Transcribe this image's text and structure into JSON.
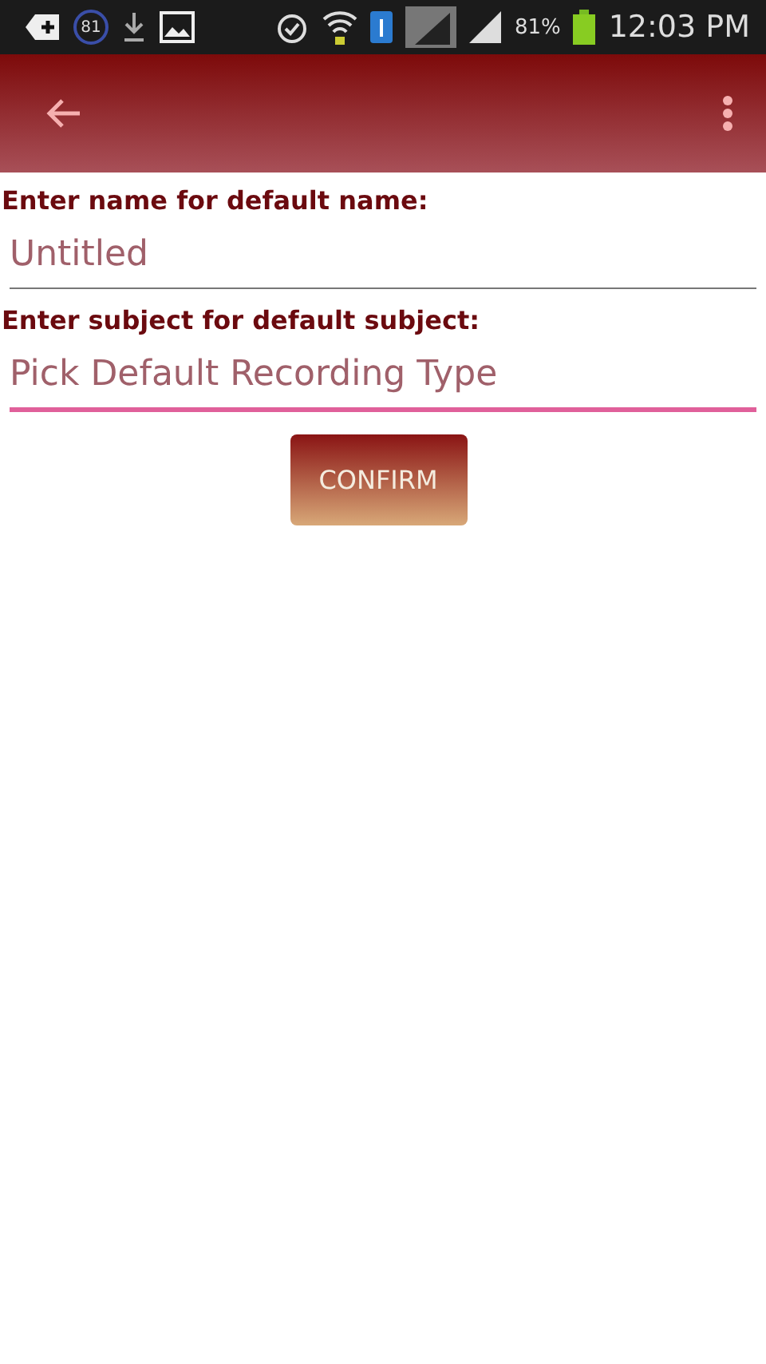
{
  "status_bar": {
    "notification_count": "81",
    "battery": "81%",
    "time": "12:03 PM"
  },
  "fields": [
    {
      "label": "Enter name for default name:",
      "placeholder": "Untitled",
      "focused": false
    },
    {
      "label": "Enter subject for default subject:",
      "placeholder": "Pick Default Recording Type",
      "focused": true
    }
  ],
  "confirm_button": "CONFIRM"
}
